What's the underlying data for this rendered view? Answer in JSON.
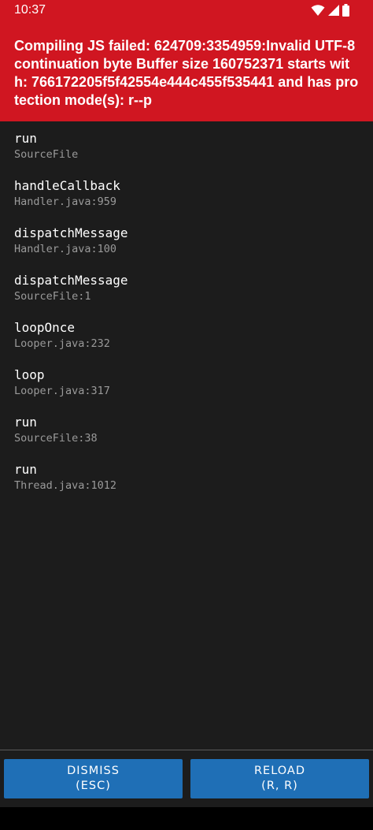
{
  "status_bar": {
    "time": "10:37",
    "icons": [
      "wifi-icon",
      "cellular-signal-icon",
      "battery-icon"
    ]
  },
  "error": {
    "message": "Compiling JS failed: 624709:3354959:Invalid UTF-8 continuation byte Buffer size 160752371 starts with: 766172205f5f42554e444c455f535441 and has protection mode(s): r--p"
  },
  "stack_frames": [
    {
      "method": "run",
      "location": "SourceFile"
    },
    {
      "method": "handleCallback",
      "location": "Handler.java:959"
    },
    {
      "method": "dispatchMessage",
      "location": "Handler.java:100"
    },
    {
      "method": "dispatchMessage",
      "location": "SourceFile:1"
    },
    {
      "method": "loopOnce",
      "location": "Looper.java:232"
    },
    {
      "method": "loop",
      "location": "Looper.java:317"
    },
    {
      "method": "run",
      "location": "SourceFile:38"
    },
    {
      "method": "run",
      "location": "Thread.java:1012"
    }
  ],
  "buttons": {
    "dismiss": {
      "label": "DISMISS",
      "shortcut": "(ESC)"
    },
    "reload": {
      "label": "RELOAD",
      "shortcut": "(R, R)"
    }
  },
  "colors": {
    "error_red": "#d01621",
    "background": "#1c1c1c",
    "button_blue": "#1f6fb6",
    "secondary_text": "#9a9a9a"
  }
}
